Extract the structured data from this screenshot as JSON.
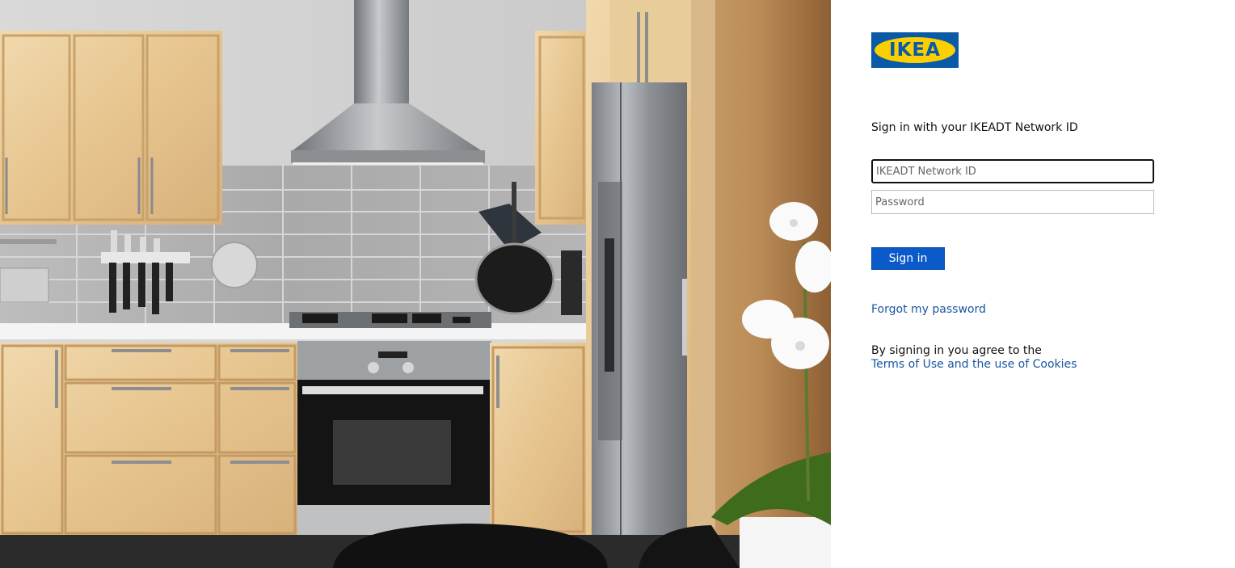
{
  "brand": {
    "logo_text": "IKEA",
    "colors": {
      "blue": "#0a5aa8",
      "yellow": "#fcd000"
    }
  },
  "illustration": {
    "subject": "kitchen"
  },
  "signin": {
    "heading": "Sign in with your IKEADT Network ID",
    "username_placeholder": "IKEADT Network ID",
    "password_placeholder": "Password",
    "button_label": "Sign in",
    "forgot_link": "Forgot my password",
    "agreement_text": "By signing in you agree to the",
    "terms_link": "Terms of Use and the use of Cookies",
    "button_color": "#0a5ac9",
    "link_color": "#1a57a0"
  }
}
